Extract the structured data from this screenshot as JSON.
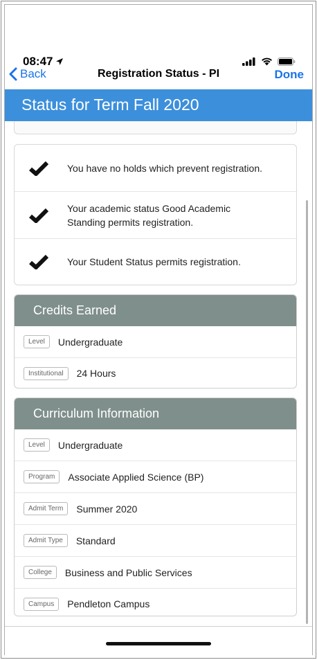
{
  "status_bar": {
    "time": "08:47"
  },
  "nav": {
    "back_label": "Back",
    "title": "Registration Status - PI",
    "done_label": "Done"
  },
  "header": {
    "title": "Status for Term Fall 2020"
  },
  "checks": [
    {
      "text": "You have no holds which prevent registration."
    },
    {
      "text": "Your academic status Good Academic Standing permits registration."
    },
    {
      "text": "Your Student Status permits registration."
    }
  ],
  "credits": {
    "title": "Credits Earned",
    "rows": [
      {
        "label": "Level",
        "value": "Undergraduate"
      },
      {
        "label": "Institutional",
        "value": "24 Hours"
      }
    ]
  },
  "curriculum": {
    "title": "Curriculum Information",
    "rows": [
      {
        "label": "Level",
        "value": "Undergraduate"
      },
      {
        "label": "Program",
        "value": "Associate Applied Science (BP)"
      },
      {
        "label": "Admit Term",
        "value": "Summer 2020"
      },
      {
        "label": "Admit Type",
        "value": "Standard"
      },
      {
        "label": "College",
        "value": "Business and Public Services"
      },
      {
        "label": "Campus",
        "value": "Pendleton Campus"
      }
    ]
  }
}
